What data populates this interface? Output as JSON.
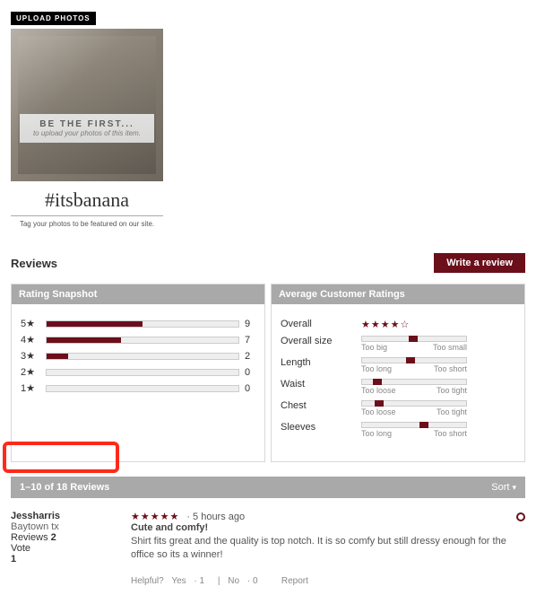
{
  "upload": {
    "button_label": "UPLOAD PHOTOS",
    "be_first_title": "BE THE FIRST...",
    "be_first_sub": "to upload your photos of this item.",
    "hashtag": "#itsbanana",
    "tagline": "Tag your photos to be featured on our site."
  },
  "reviews_heading": "Reviews",
  "write_review_label": "Write a review",
  "snapshot_title": "Rating Snapshot",
  "avg_title": "Average Customer Ratings",
  "pagination": "1–10 of 18 Reviews",
  "sort_label": "Sort",
  "rating_rows": [
    {
      "label": "5★",
      "count": "9",
      "pct": 50
    },
    {
      "label": "4★",
      "count": "7",
      "pct": 39
    },
    {
      "label": "3★",
      "count": "2",
      "pct": 11
    },
    {
      "label": "2★",
      "count": "0",
      "pct": 0
    },
    {
      "label": "1★",
      "count": "0",
      "pct": 0
    }
  ],
  "avg": {
    "overall_label": "Overall",
    "overall_stars": "★★★★☆",
    "sliders": [
      {
        "label": "Overall size",
        "left": "Too big",
        "right": "Too small",
        "pos": 45
      },
      {
        "label": "Length",
        "left": "Too long",
        "right": "Too short",
        "pos": 42
      },
      {
        "label": "Waist",
        "left": "Too loose",
        "right": "Too tight",
        "pos": 10
      },
      {
        "label": "Chest",
        "left": "Too loose",
        "right": "Too tight",
        "pos": 12
      },
      {
        "label": "Sleeves",
        "left": "Too long",
        "right": "Too short",
        "pos": 55
      }
    ]
  },
  "review": {
    "username": "Jessharris",
    "location": "Baytown tx",
    "reviews_label": "Reviews",
    "reviews_count": "2",
    "vote_label": "Vote",
    "vote_count": "1",
    "stars": "★★★★★",
    "age": "· 5 hours ago",
    "title": "Cute and comfy!",
    "text": "Shirt fits great and the quality is top notch. It is so comfy but still dressy enough for the office so its a winner!",
    "helpful_label": "Helpful?",
    "yes_label": "Yes",
    "yes_count": "1",
    "no_label": "No",
    "no_count": "0",
    "report_label": "Report"
  }
}
